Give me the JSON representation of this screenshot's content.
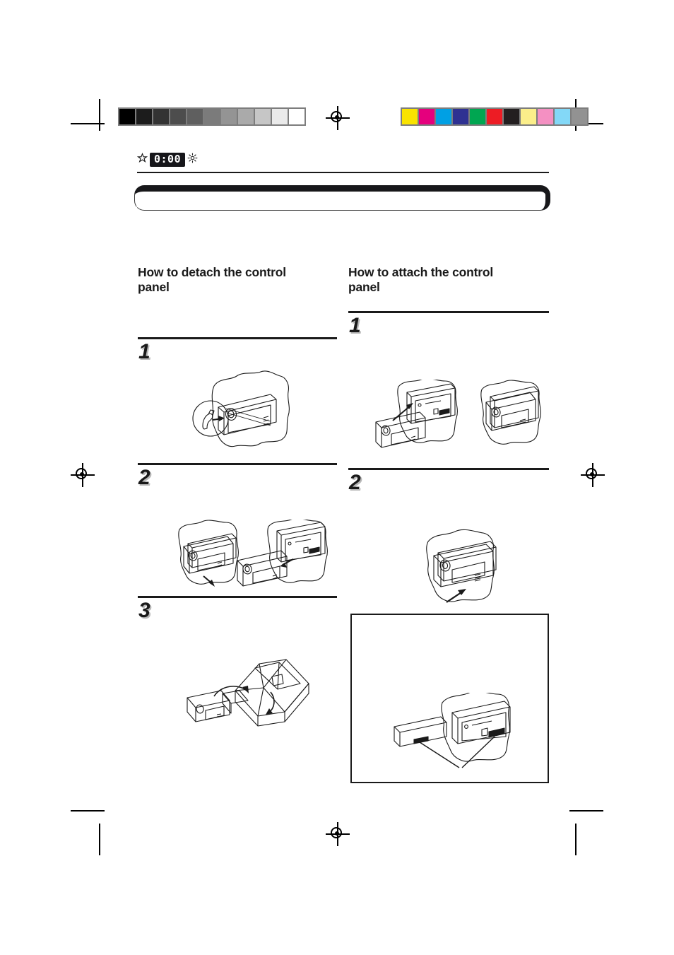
{
  "document": {
    "type": "scanned-manual-page",
    "page_background": "#ffffff",
    "ink_color": "#1a1a1a"
  },
  "prepress": {
    "grayscale_wedge": {
      "name": "grayscale-step-wedge",
      "steps": [
        "#000000",
        "#1c1c1c",
        "#333333",
        "#4d4d4d",
        "#5f5f5f",
        "#7b7b7b",
        "#949494",
        "#aaaaaa",
        "#c6c6c6",
        "#eaeaea",
        "#ffffff"
      ]
    },
    "color_bar": {
      "name": "process-color-bar",
      "swatches": [
        "#f9e300",
        "#e5007d",
        "#00a0e4",
        "#2e3192",
        "#00a651",
        "#ed1c24",
        "#231f20",
        "#fbee8a",
        "#f490c2",
        "#83d8f7",
        "#929292"
      ]
    },
    "registration_targets": 4,
    "crop_marks": 8
  },
  "header": {
    "star_icon": "star-icon",
    "clock_display": "0:00",
    "gear_icon": "gear-icon"
  },
  "banner": {
    "label": "",
    "style": "rounded-rectangle-with-heavy-top-edge"
  },
  "columns": {
    "left": {
      "heading": "How to detach the control panel",
      "steps": [
        {
          "number": "1",
          "illustration": "press-release-button-with-magnifier-callout"
        },
        {
          "number": "2",
          "illustration": "panel-swings-open-then-lifts-off"
        },
        {
          "number": "3",
          "illustration": "store-panel-in-carrying-case"
        }
      ]
    },
    "right": {
      "heading": "How to attach the control panel",
      "steps": [
        {
          "number": "1",
          "illustration": "hook-panel-onto-left-side-of-unit"
        },
        {
          "number": "2",
          "illustration": "press-panel-closed"
        }
      ],
      "note_box": {
        "illustration": "align-panel-connector-with-unit-connector",
        "caption": ""
      }
    }
  }
}
